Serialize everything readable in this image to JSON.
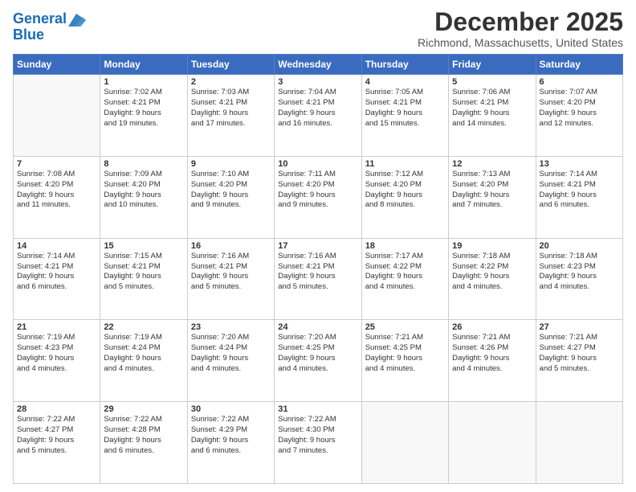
{
  "header": {
    "logo_line1": "General",
    "logo_line2": "Blue",
    "month_title": "December 2025",
    "location": "Richmond, Massachusetts, United States"
  },
  "weekdays": [
    "Sunday",
    "Monday",
    "Tuesday",
    "Wednesday",
    "Thursday",
    "Friday",
    "Saturday"
  ],
  "weeks": [
    [
      {
        "day": "",
        "info": ""
      },
      {
        "day": "1",
        "info": "Sunrise: 7:02 AM\nSunset: 4:21 PM\nDaylight: 9 hours\nand 19 minutes."
      },
      {
        "day": "2",
        "info": "Sunrise: 7:03 AM\nSunset: 4:21 PM\nDaylight: 9 hours\nand 17 minutes."
      },
      {
        "day": "3",
        "info": "Sunrise: 7:04 AM\nSunset: 4:21 PM\nDaylight: 9 hours\nand 16 minutes."
      },
      {
        "day": "4",
        "info": "Sunrise: 7:05 AM\nSunset: 4:21 PM\nDaylight: 9 hours\nand 15 minutes."
      },
      {
        "day": "5",
        "info": "Sunrise: 7:06 AM\nSunset: 4:21 PM\nDaylight: 9 hours\nand 14 minutes."
      },
      {
        "day": "6",
        "info": "Sunrise: 7:07 AM\nSunset: 4:20 PM\nDaylight: 9 hours\nand 12 minutes."
      }
    ],
    [
      {
        "day": "7",
        "info": "Sunrise: 7:08 AM\nSunset: 4:20 PM\nDaylight: 9 hours\nand 11 minutes."
      },
      {
        "day": "8",
        "info": "Sunrise: 7:09 AM\nSunset: 4:20 PM\nDaylight: 9 hours\nand 10 minutes."
      },
      {
        "day": "9",
        "info": "Sunrise: 7:10 AM\nSunset: 4:20 PM\nDaylight: 9 hours\nand 9 minutes."
      },
      {
        "day": "10",
        "info": "Sunrise: 7:11 AM\nSunset: 4:20 PM\nDaylight: 9 hours\nand 9 minutes."
      },
      {
        "day": "11",
        "info": "Sunrise: 7:12 AM\nSunset: 4:20 PM\nDaylight: 9 hours\nand 8 minutes."
      },
      {
        "day": "12",
        "info": "Sunrise: 7:13 AM\nSunset: 4:20 PM\nDaylight: 9 hours\nand 7 minutes."
      },
      {
        "day": "13",
        "info": "Sunrise: 7:14 AM\nSunset: 4:21 PM\nDaylight: 9 hours\nand 6 minutes."
      }
    ],
    [
      {
        "day": "14",
        "info": "Sunrise: 7:14 AM\nSunset: 4:21 PM\nDaylight: 9 hours\nand 6 minutes."
      },
      {
        "day": "15",
        "info": "Sunrise: 7:15 AM\nSunset: 4:21 PM\nDaylight: 9 hours\nand 5 minutes."
      },
      {
        "day": "16",
        "info": "Sunrise: 7:16 AM\nSunset: 4:21 PM\nDaylight: 9 hours\nand 5 minutes."
      },
      {
        "day": "17",
        "info": "Sunrise: 7:16 AM\nSunset: 4:21 PM\nDaylight: 9 hours\nand 5 minutes."
      },
      {
        "day": "18",
        "info": "Sunrise: 7:17 AM\nSunset: 4:22 PM\nDaylight: 9 hours\nand 4 minutes."
      },
      {
        "day": "19",
        "info": "Sunrise: 7:18 AM\nSunset: 4:22 PM\nDaylight: 9 hours\nand 4 minutes."
      },
      {
        "day": "20",
        "info": "Sunrise: 7:18 AM\nSunset: 4:23 PM\nDaylight: 9 hours\nand 4 minutes."
      }
    ],
    [
      {
        "day": "21",
        "info": "Sunrise: 7:19 AM\nSunset: 4:23 PM\nDaylight: 9 hours\nand 4 minutes."
      },
      {
        "day": "22",
        "info": "Sunrise: 7:19 AM\nSunset: 4:24 PM\nDaylight: 9 hours\nand 4 minutes."
      },
      {
        "day": "23",
        "info": "Sunrise: 7:20 AM\nSunset: 4:24 PM\nDaylight: 9 hours\nand 4 minutes."
      },
      {
        "day": "24",
        "info": "Sunrise: 7:20 AM\nSunset: 4:25 PM\nDaylight: 9 hours\nand 4 minutes."
      },
      {
        "day": "25",
        "info": "Sunrise: 7:21 AM\nSunset: 4:25 PM\nDaylight: 9 hours\nand 4 minutes."
      },
      {
        "day": "26",
        "info": "Sunrise: 7:21 AM\nSunset: 4:26 PM\nDaylight: 9 hours\nand 4 minutes."
      },
      {
        "day": "27",
        "info": "Sunrise: 7:21 AM\nSunset: 4:27 PM\nDaylight: 9 hours\nand 5 minutes."
      }
    ],
    [
      {
        "day": "28",
        "info": "Sunrise: 7:22 AM\nSunset: 4:27 PM\nDaylight: 9 hours\nand 5 minutes."
      },
      {
        "day": "29",
        "info": "Sunrise: 7:22 AM\nSunset: 4:28 PM\nDaylight: 9 hours\nand 6 minutes."
      },
      {
        "day": "30",
        "info": "Sunrise: 7:22 AM\nSunset: 4:29 PM\nDaylight: 9 hours\nand 6 minutes."
      },
      {
        "day": "31",
        "info": "Sunrise: 7:22 AM\nSunset: 4:30 PM\nDaylight: 9 hours\nand 7 minutes."
      },
      {
        "day": "",
        "info": ""
      },
      {
        "day": "",
        "info": ""
      },
      {
        "day": "",
        "info": ""
      }
    ]
  ]
}
